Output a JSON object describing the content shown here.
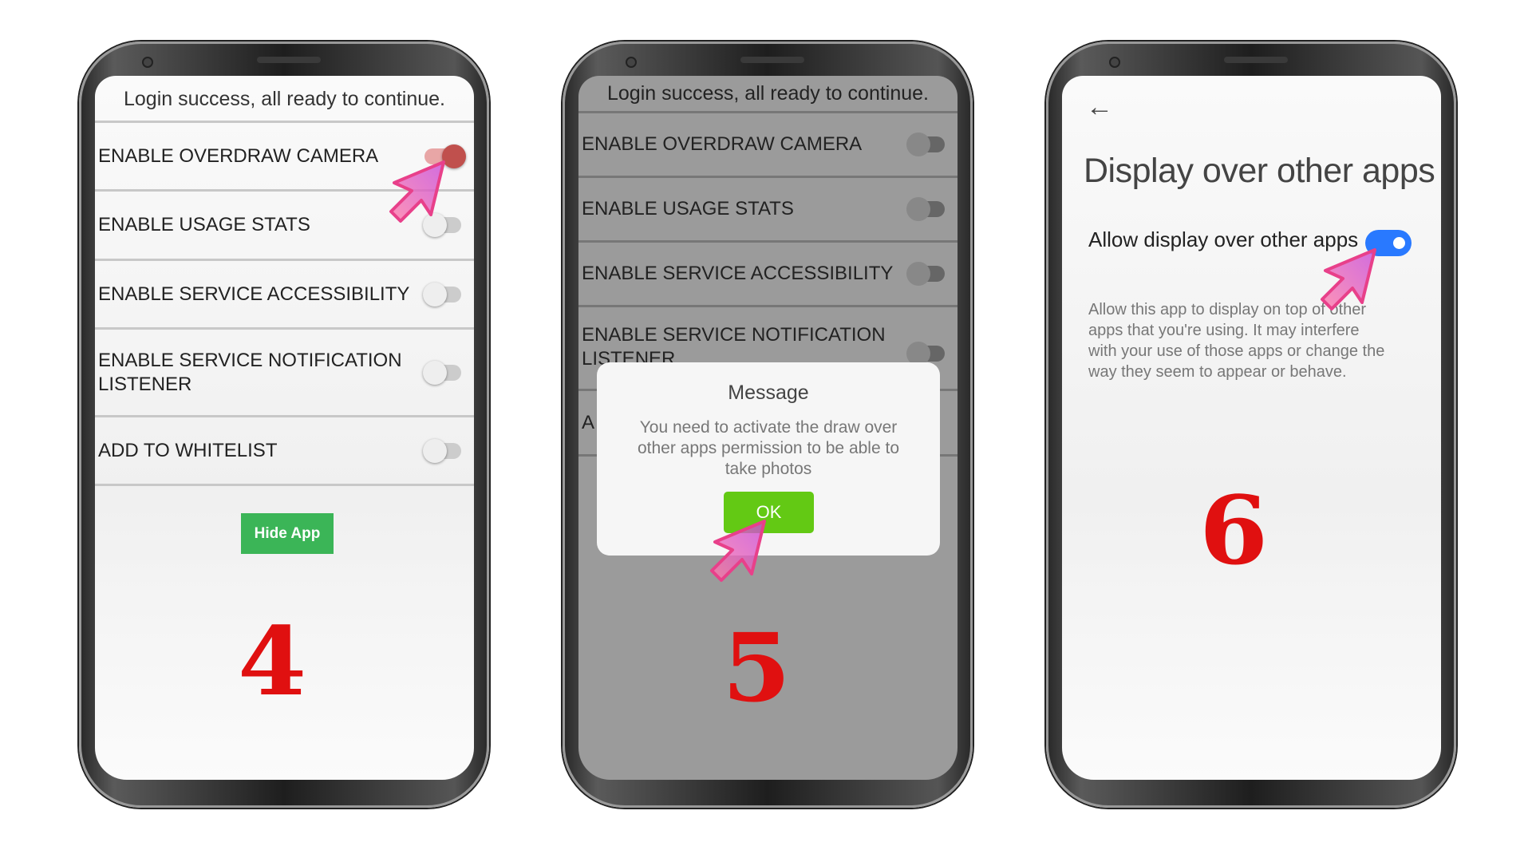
{
  "colors": {
    "step_number": "#e01010",
    "hide_button": "#3bb557",
    "ok_button": "#63c914",
    "toggle_on_blue": "#2979ff",
    "toggle_on_red": "#c0504d",
    "cursor": "#e8408a"
  },
  "step4": {
    "header": "Login success, all ready to continue.",
    "rows": [
      {
        "label": "ENABLE OVERDRAW CAMERA",
        "on": true
      },
      {
        "label": "ENABLE USAGE STATS",
        "on": false
      },
      {
        "label": "ENABLE SERVICE ACCESSIBILITY",
        "on": false
      },
      {
        "label": "ENABLE SERVICE NOTIFICATION LISTENER",
        "on": false
      },
      {
        "label": "ADD TO WHITELIST",
        "on": false
      }
    ],
    "hide_button": "Hide App",
    "number": "4"
  },
  "step5": {
    "header": "Login success, all ready to continue.",
    "rows": [
      {
        "label": "ENABLE OVERDRAW CAMERA"
      },
      {
        "label": "ENABLE USAGE STATS"
      },
      {
        "label": "ENABLE SERVICE ACCESSIBILITY"
      },
      {
        "label": "ENABLE SERVICE NOTIFICATION LISTENER"
      },
      {
        "label": "A"
      }
    ],
    "dialog": {
      "title": "Message",
      "body": "You need to activate the draw over other apps permission to be able to take photos",
      "ok": "OK"
    },
    "number": "5"
  },
  "step6": {
    "back_icon": "arrow-left",
    "title": "Display over other apps",
    "toggle_label": "Allow display over other apps",
    "toggle_on": true,
    "description": "Allow this app to display on top of other apps that you're using. It may interfere with your use of those apps or change the way they seem to appear or behave.",
    "number": "6"
  }
}
